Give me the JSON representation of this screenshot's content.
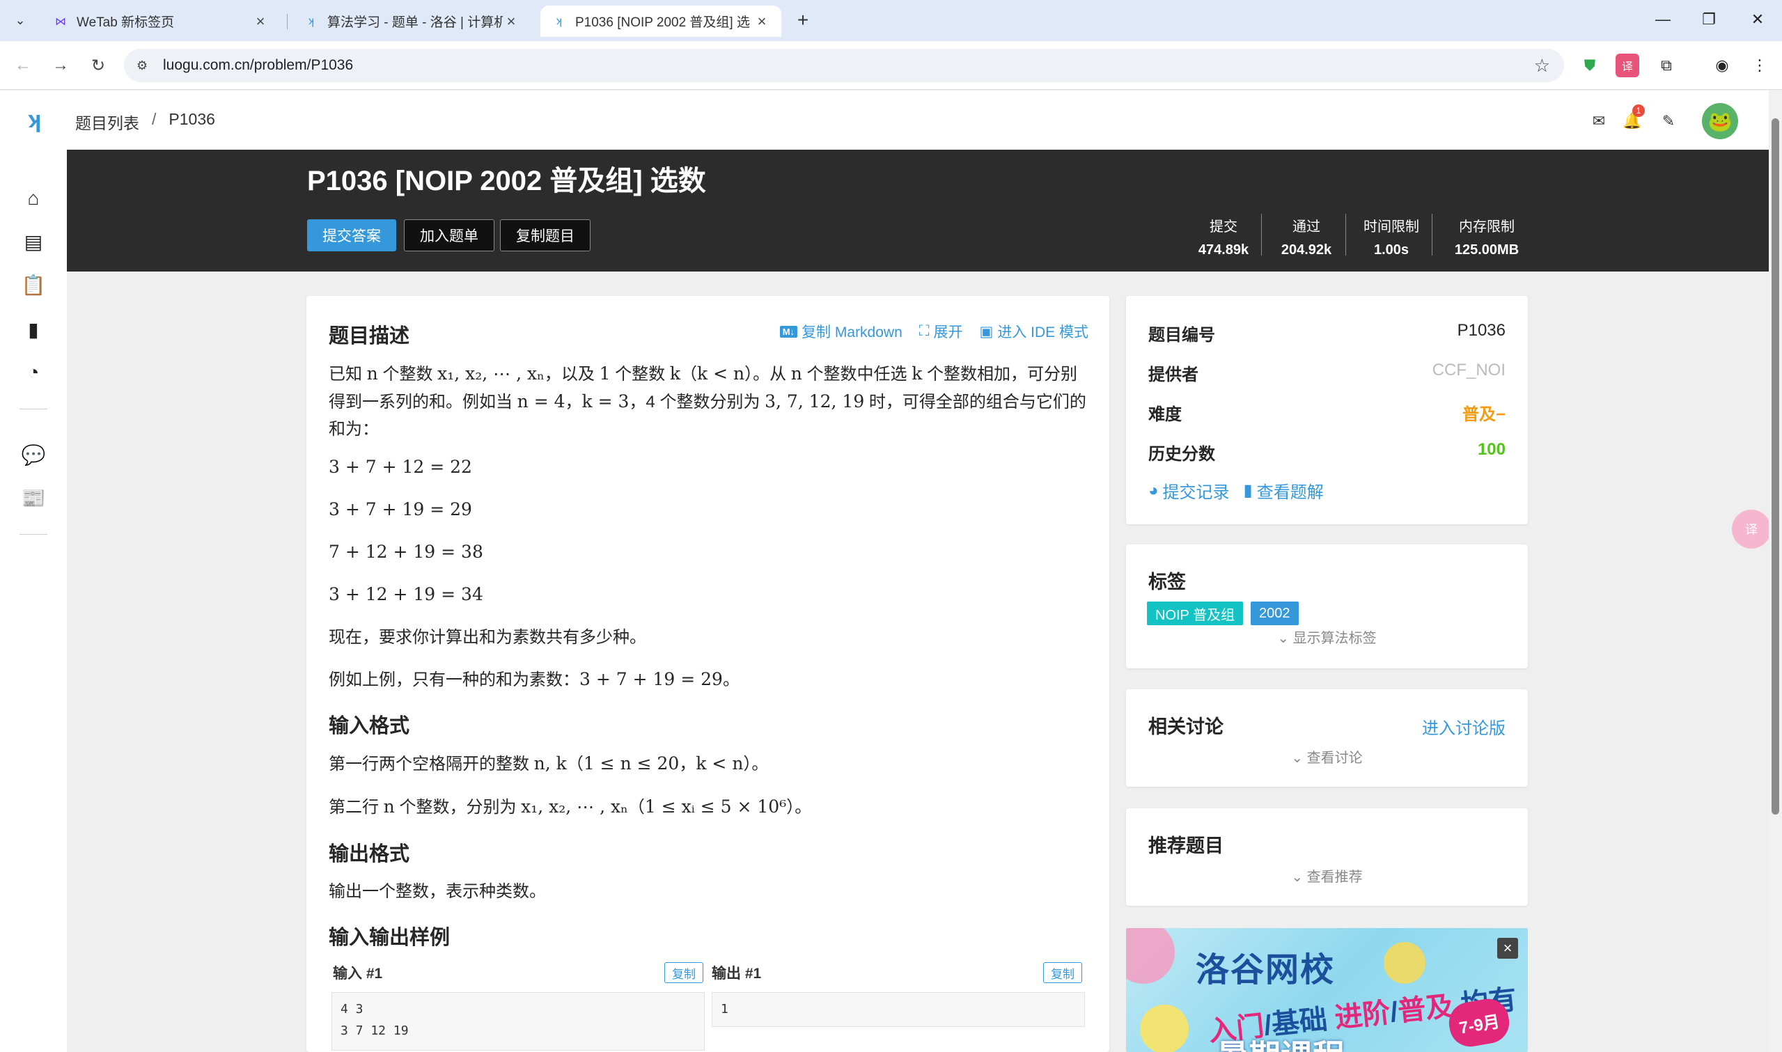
{
  "browser": {
    "tabs": [
      {
        "title": "WeTab 新标签页",
        "icon": "wetab-icon"
      },
      {
        "title": "算法学习 - 题单 - 洛谷 | 计算机",
        "icon": "luogu-icon"
      },
      {
        "title": "P1036 [NOIP 2002 普及组] 选",
        "icon": "luogu-icon"
      }
    ],
    "url": "luogu.com.cn/problem/P1036"
  },
  "header": {
    "breadcrumb": [
      "题目列表",
      "/",
      "P1036"
    ],
    "notification_count": "1"
  },
  "problem": {
    "title": "P1036 [NOIP 2002 普及组] 选数",
    "buttons": {
      "submit": "提交答案",
      "add_list": "加入题单",
      "copy": "复制题目"
    },
    "stats": [
      {
        "label": "提交",
        "value": "474.89k"
      },
      {
        "label": "通过",
        "value": "204.92k"
      },
      {
        "label": "时间限制",
        "value": "1.00s"
      },
      {
        "label": "内存限制",
        "value": "125.00MB"
      }
    ],
    "sections": {
      "description": "题目描述",
      "input_format": "输入格式",
      "output_format": "输出格式",
      "samples": "输入输出样例"
    },
    "actions": {
      "md_icon": "M↓",
      "copy_md": "复制 Markdown",
      "expand": "展开",
      "ide": "进入 IDE 模式"
    },
    "desc": {
      "p1_a": "已知 ",
      "p1_m1": "n",
      "p1_b": " 个整数 ",
      "p1_m2": "x₁, x₂, ⋯ , xₙ",
      "p1_c": "，以及 ",
      "p1_m3": "1",
      "p1_d": " 个整数 ",
      "p1_m4": "k",
      "p1_e": "（",
      "p1_m5": "k < n",
      "p1_f": "）。从 ",
      "p1_m6": "n",
      "p1_g": " 个整数中任选 ",
      "p1_m7": "k",
      "p1_h": " 个整数相加，可分别得到一系列的和。例如当 ",
      "p1_m8": "n = 4",
      "p1_i": "，",
      "p1_m9": "k = 3",
      "p1_j": "，4 个整数分别为 ",
      "p1_m10": "3, 7, 12, 19",
      "p1_k": " 时，可得全部的组合与它们的和为：",
      "eq1": "3 + 7 + 12 = 22",
      "eq2": "3 + 7 + 19 = 29",
      "eq3": "7 + 12 + 19 = 38",
      "eq4": "3 + 12 + 19 = 34",
      "p2": "现在，要求你计算出和为素数共有多少种。",
      "p3_a": "例如上例，只有一种的和为素数：",
      "p3_m": "3 + 7 + 19 = 29",
      "p3_b": "。"
    },
    "input": {
      "l1_a": "第一行两个空格隔开的整数 ",
      "l1_m1": "n, k",
      "l1_b": "（",
      "l1_m2": "1 ≤ n ≤ 20",
      "l1_c": "，",
      "l1_m3": "k < n",
      "l1_d": "）。",
      "l2_a": "第二行 ",
      "l2_m1": "n",
      "l2_b": " 个整数，分别为 ",
      "l2_m2": "x₁, x₂, ⋯ , xₙ",
      "l2_c": "（",
      "l2_m3": "1 ≤ xᵢ ≤ 5 × 10⁶",
      "l2_d": "）。"
    },
    "output": {
      "text": "输出一个整数，表示种类数。"
    },
    "sample": {
      "in_label": "输入 #1",
      "out_label": "输出 #1",
      "copy": "复制",
      "in_lines": [
        "4 3",
        "3 7 12 19"
      ],
      "out_lines": [
        "1"
      ]
    }
  },
  "info": {
    "rows": [
      {
        "key": "题目编号",
        "value": "P1036",
        "color": "#262626"
      },
      {
        "key": "提供者",
        "value": "CCF_NOI",
        "color": "#bbbbbb"
      },
      {
        "key": "难度",
        "value": "普及−",
        "color": "#f39c11"
      },
      {
        "key": "历史分数",
        "value": "100",
        "color": "#52c41a"
      }
    ],
    "links": {
      "records": "提交记录",
      "solutions": "查看题解"
    }
  },
  "tags": {
    "title": "标签",
    "items": [
      {
        "label": "NOIP 普及组",
        "color": "#13c2c2"
      },
      {
        "label": "2002",
        "color": "#3498db"
      }
    ],
    "toggle": "显示算法标签"
  },
  "discussion": {
    "title": "相关讨论",
    "link": "进入讨论版",
    "toggle": "查看讨论"
  },
  "recommend": {
    "title": "推荐题目",
    "toggle": "查看推荐"
  },
  "ad": {
    "title": "洛谷网校",
    "sub_a": "入门",
    "sub_sep": "/",
    "sub_b": "基础",
    "sub_c": "进阶",
    "sub_d": "普及",
    "sub_e": "均有开设",
    "badge": "7-9月",
    "bottom": "暑期课程"
  },
  "colors": {
    "accent": "#3498db",
    "banner": "#2c2c2c"
  }
}
